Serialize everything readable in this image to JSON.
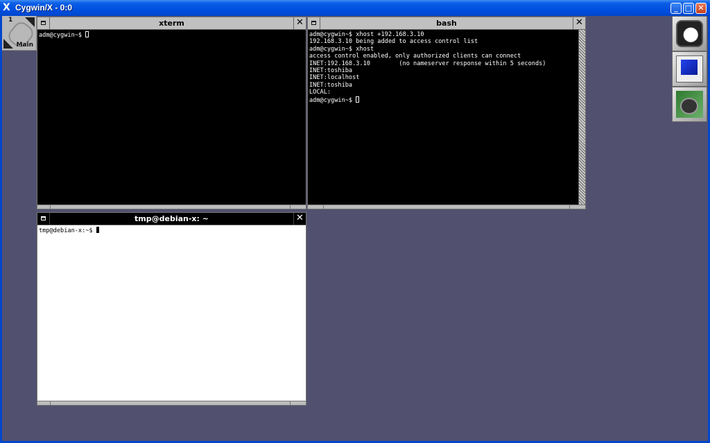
{
  "window": {
    "icon": "X",
    "title": "Cygwin/X - 0:0",
    "minimize_icon": "minimize-icon",
    "maximize_icon": "maximize-icon",
    "close_icon": "close-icon"
  },
  "pager": {
    "number": "1",
    "label": "Main",
    "icon": "paperclip-icon"
  },
  "dock": [
    {
      "name": "dock-app-1",
      "icon": "window-manager-icon"
    },
    {
      "name": "dock-app-2",
      "icon": "monitor-icon"
    },
    {
      "name": "dock-app-3",
      "icon": "graphics-app-icon"
    }
  ],
  "xterm": {
    "title": "xterm",
    "lines": [
      "adm@cygwin~$ "
    ]
  },
  "bash": {
    "title": "bash",
    "lines": [
      "adm@cygwin~$ xhost +192.168.3.10",
      "192.168.3.10 being added to access control list",
      "adm@cygwin~$ xhost",
      "access control enabled, only authorized clients can connect",
      "INET:192.168.3.10        (no nameserver response within 5 seconds)",
      "INET:toshiba",
      "INET:localhost",
      "INET:toshiba",
      "LOCAL:",
      "adm@cygwin~$ "
    ]
  },
  "debian": {
    "title": "tmp@debian-x: ~",
    "lines": [
      "tmp@debian-x:~$ "
    ]
  }
}
